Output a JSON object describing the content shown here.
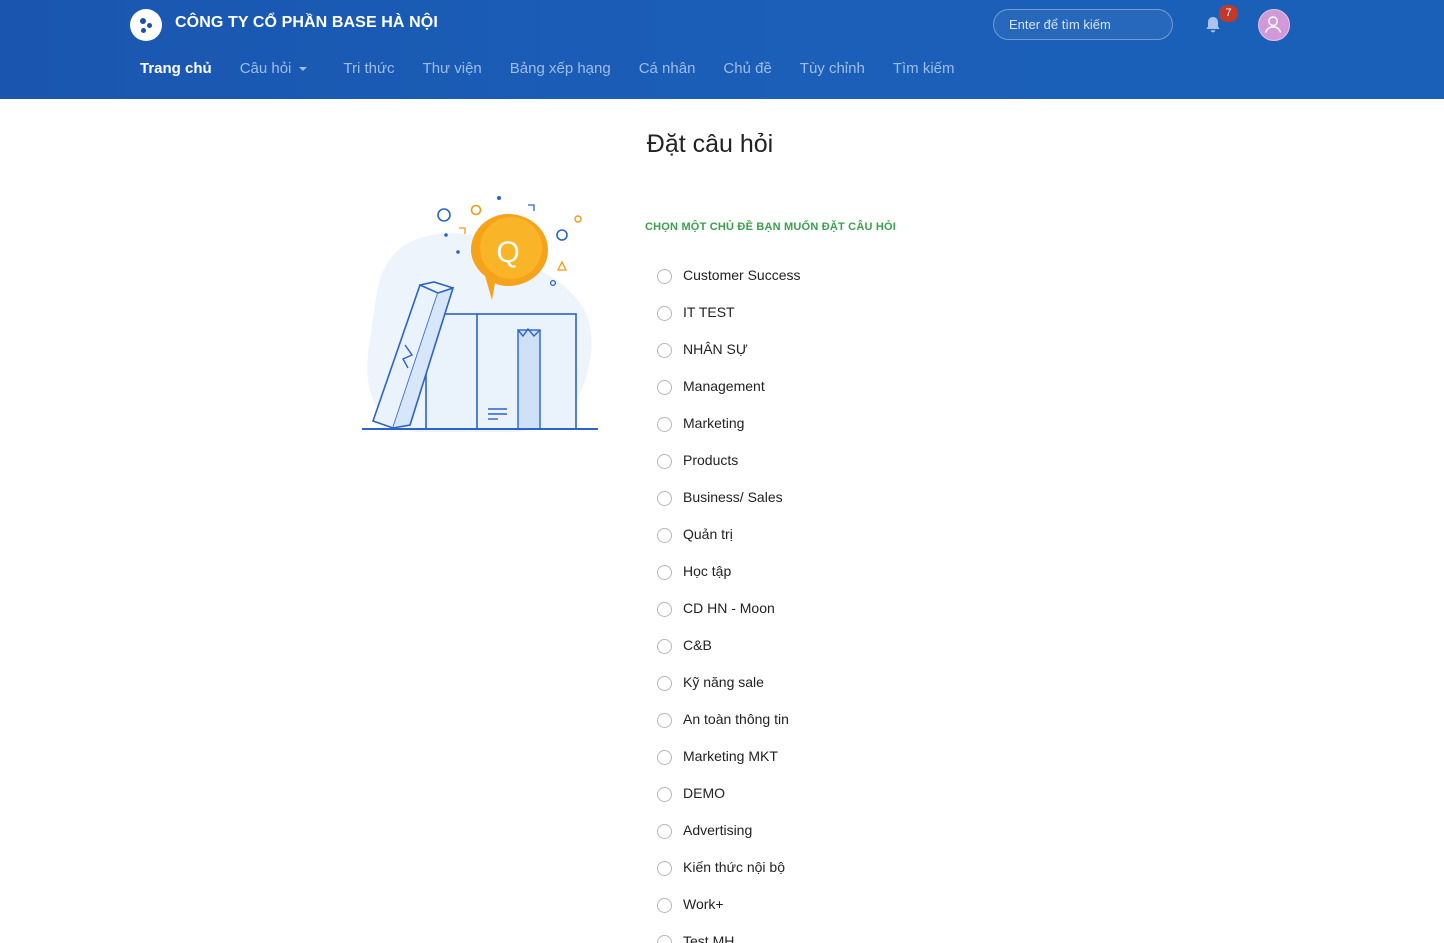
{
  "header": {
    "company_name": "CÔNG TY CỔ PHẦN BASE HÀ NỘI",
    "search_placeholder": "Enter để tìm kiếm",
    "notification_count": "7",
    "brand_color": "#1a56b0",
    "badge_color": "#c0392b",
    "avatar_color": "#d199d8"
  },
  "nav": {
    "items": [
      {
        "label": "Trang chủ",
        "active": true
      },
      {
        "label": "Câu hỏi",
        "dropdown": true
      },
      {
        "label": "Tri thức"
      },
      {
        "label": "Thư viện"
      },
      {
        "label": "Bảng xếp hạng"
      },
      {
        "label": "Cá nhân"
      },
      {
        "label": "Chủ đề"
      },
      {
        "label": "Tùy chỉnh"
      },
      {
        "label": "Tìm kiếm"
      }
    ]
  },
  "main": {
    "title": "Đặt câu hỏi",
    "illustration_letter": "Q",
    "topics_heading": "CHỌN MỘT CHỦ ĐỀ BẠN MUỐN ĐẶT CÂU HỎI",
    "heading_color": "#3aa14a",
    "topics": [
      "Customer Success",
      "IT TEST",
      "NHÂN SỰ",
      "Management",
      "Marketing",
      "Products",
      "Business/ Sales",
      "Quản trị",
      "Học tập",
      "CD HN - Moon",
      "C&B",
      "Kỹ năng sale",
      "An toàn thông tin",
      "Marketing MKT",
      "DEMO",
      "Advertising",
      "Kiến thức nội bộ",
      "Work+",
      "Test MH"
    ]
  }
}
